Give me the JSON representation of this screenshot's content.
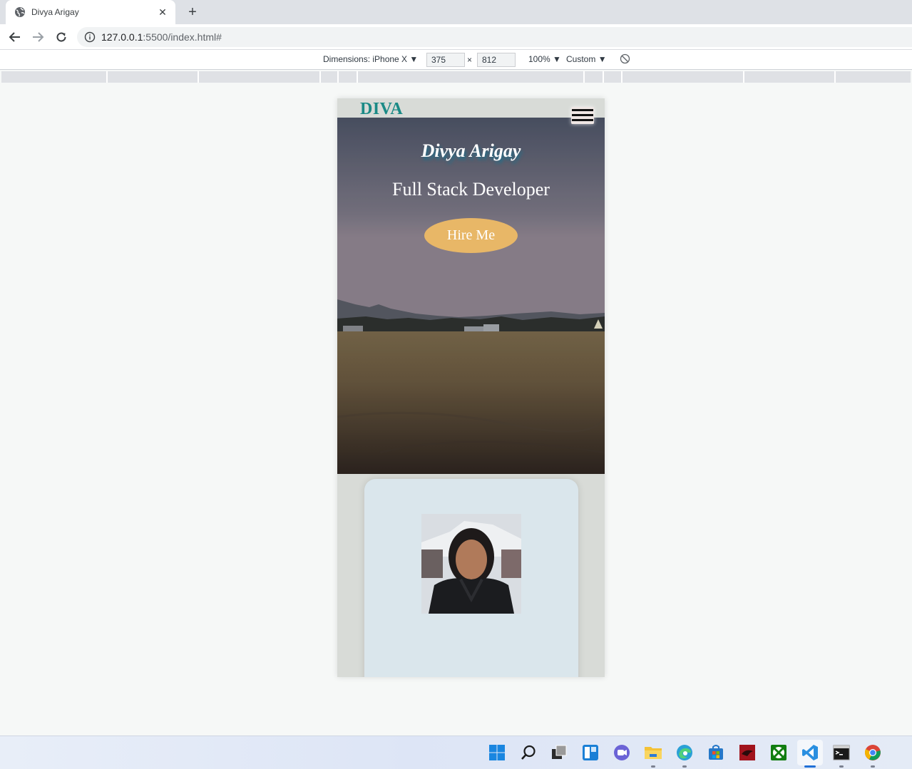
{
  "browser": {
    "tab_title": "Divya Arigay",
    "tab_close": "✕",
    "new_tab": "+",
    "url_host": "127.0.0.1",
    "url_rest": ":5500/index.html#"
  },
  "devtools": {
    "dimensions_label": "Dimensions: iPhone X",
    "width": "375",
    "times": "×",
    "height": "812",
    "zoom": "100%",
    "throttle": "Custom"
  },
  "site": {
    "logo": "DIVA",
    "hero_name": "Divya Arigay",
    "hero_role": "Full Stack Developer",
    "hire_button": "Hire Me"
  },
  "taskbar": {
    "icons": [
      "windows-start-icon",
      "search-icon",
      "task-view-icon",
      "widgets-icon",
      "teams-chat-icon",
      "file-explorer-icon",
      "edge-icon",
      "store-icon",
      "app-icon",
      "xbox-icon",
      "vscode-icon",
      "terminal-icon",
      "chrome-icon"
    ]
  },
  "colors": {
    "logo": "#1a8a86",
    "hire_button": "#e8b767",
    "card": "#dae6ec",
    "page_bg": "#d8dbd7"
  }
}
